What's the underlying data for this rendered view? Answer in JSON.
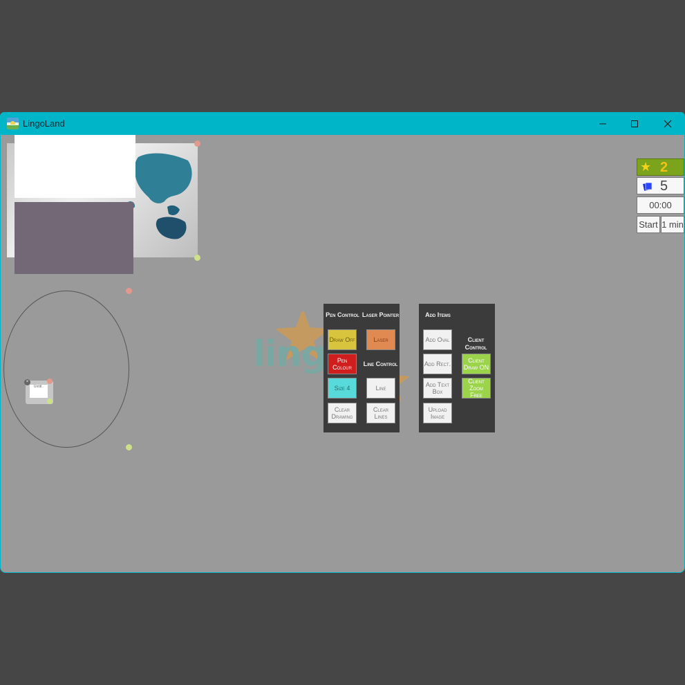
{
  "window": {
    "title": "LingoLand",
    "icons": {
      "app": "lingoland-app-icon",
      "minimize": "minimize-icon",
      "maximize": "maximize-icon",
      "close": "close-icon"
    }
  },
  "canvas": {
    "mini_card_text": "Untitl..",
    "mini_close_glyph": "×",
    "logo_text": "lingo"
  },
  "pen_control": {
    "header": "Pen Control",
    "draw": "Draw Off",
    "colour": "Pen Colour",
    "size": "Size 4",
    "clear": "Clear Drawing"
  },
  "laser_pointer": {
    "header": "Laser Pointer",
    "laser": "Laser"
  },
  "line_control": {
    "header": "Line Control",
    "line": "Line",
    "clear": "Clear Lines"
  },
  "add_items": {
    "header": "Add Items",
    "oval": "Add Oval",
    "rect": "Add Rect.",
    "textbox": "Add Text Box",
    "upload": "Upload Image"
  },
  "client_control": {
    "header": "Client Control",
    "draw": "Client Draw ON",
    "zoom": "Client Zoom Free"
  },
  "scoreboard": {
    "stars": "2",
    "cards": "5",
    "timer": "00:00",
    "start": "Start",
    "duration": "1 min",
    "icons": {
      "star": "star-icon",
      "cards": "cards-icon"
    }
  },
  "colors": {
    "titlebar": "#00b5c8",
    "canvas": "#9a9a9a",
    "panel": "#3b3b3b",
    "pen_colour": "#d01d1d"
  }
}
